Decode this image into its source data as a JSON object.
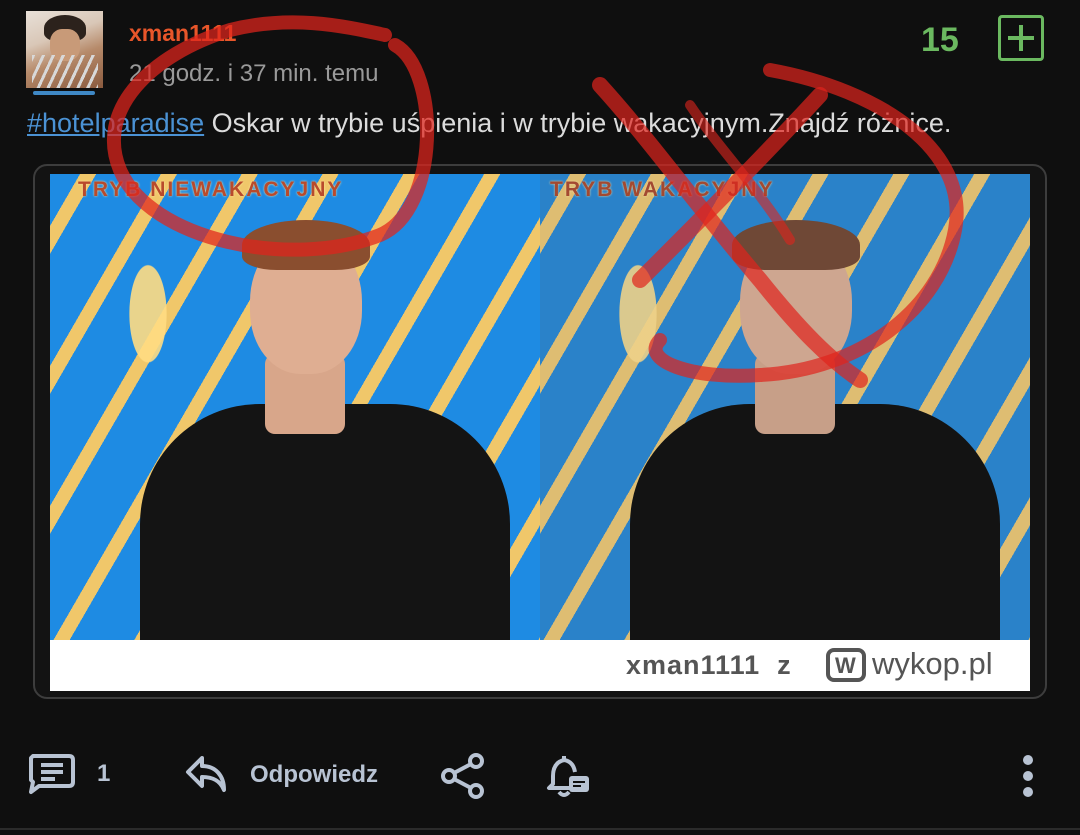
{
  "author": {
    "username": "xman1111",
    "timestamp": "21 godz. i 37 min. temu",
    "avatar_icon": "avatar-user-icon"
  },
  "vote": {
    "count": "15",
    "plus_icon": "plus-icon"
  },
  "post": {
    "hashtag": "#hotelparadise",
    "text": " Oskar w trybie uśpienia i w trybie wakacyjnym.Znajdź różnice."
  },
  "embed": {
    "left_label": "TRYB NIEWAKACYJNY",
    "right_label": "TRYB WAKACYJNY",
    "watermark_user": "xman1111",
    "watermark_conj": "z",
    "watermark_logo": "W",
    "watermark_site": "wykop.pl"
  },
  "actions": {
    "comments_count": "1",
    "reply_label": "Odpowiedz",
    "comments_icon": "comments-icon",
    "reply_icon": "reply-icon",
    "share_icon": "share-icon",
    "notify_icon": "bell-icon",
    "more_icon": "more-vertical-icon"
  },
  "colors": {
    "username": "#e8562a",
    "vote": "#6bb960",
    "hashtag": "#4b92d4",
    "scribble": "#e0241c"
  }
}
